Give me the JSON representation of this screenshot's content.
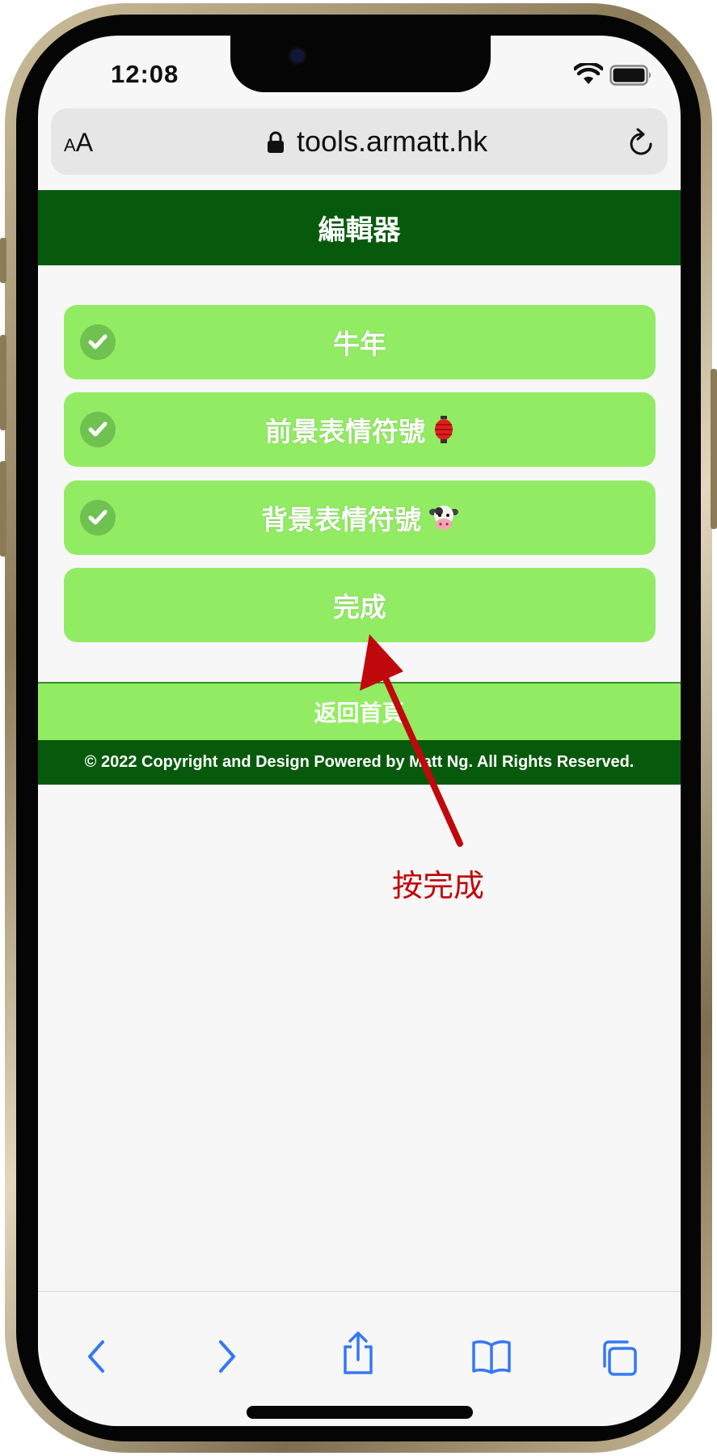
{
  "status_bar": {
    "time": "12:08"
  },
  "browser": {
    "text_size_label_small": "A",
    "text_size_label_large": "A",
    "url": "tools.armatt.hk"
  },
  "app": {
    "header_title": "編輯器",
    "options": [
      {
        "label": "牛年",
        "checked": true,
        "emoji": ""
      },
      {
        "label": "前景表情符號",
        "checked": true,
        "emoji": "🏮"
      },
      {
        "label": "背景表情符號",
        "checked": true,
        "emoji": "🐮"
      }
    ],
    "done_label": "完成",
    "home_label": "返回首頁",
    "footer_text": "© 2022 Copyright and Design Powered by Matt Ng. All Rights Reserved."
  },
  "annotation": {
    "text": "按完成",
    "color": "#c0090c"
  },
  "colors": {
    "header_green": "#075a0c",
    "button_green": "#92ec63",
    "check_green": "#6fc150",
    "ios_blue": "#3478f6"
  },
  "toolbar_icons": [
    "back-icon",
    "forward-icon",
    "share-icon",
    "bookmarks-icon",
    "tabs-icon"
  ]
}
